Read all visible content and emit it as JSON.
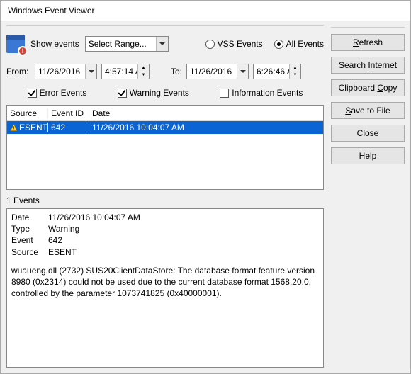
{
  "windowTitle": "Windows Event Viewer",
  "top": {
    "showEvents": "Show events",
    "selectRange": "Select Range...",
    "vssEvents": "VSS Events",
    "allEvents": "All Events"
  },
  "range": {
    "fromLabel": "From:",
    "fromDate": "11/26/2016",
    "fromTime": "4:57:14 A",
    "toLabel": "To:",
    "toDate": "11/26/2016",
    "toTime": "6:26:46 A"
  },
  "filters": {
    "error": "Error Events",
    "warning": "Warning Events",
    "info": "Information Events"
  },
  "columns": {
    "source": "Source",
    "eventId": "Event ID",
    "date": "Date"
  },
  "rows": [
    {
      "source": "ESENT",
      "eventId": "642",
      "date": "11/26/2016 10:04:07 AM"
    }
  ],
  "countLabel": "1 Events",
  "detail": {
    "dateLabel": "Date",
    "dateVal": "11/26/2016 10:04:07 AM",
    "typeLabel": "Type",
    "typeVal": "Warning",
    "eventLabel": "Event",
    "eventVal": "642",
    "sourceLabel": "Source",
    "sourceVal": "ESENT",
    "body": "wuaueng.dll (2732) SUS20ClientDataStore: The database format feature version 8980 (0x2314) could not be used due to the current database format 1568.20.0, controlled by the parameter 1073741825 (0x40000001)."
  },
  "buttons": {
    "refresh": "efresh",
    "search": "nternet",
    "searchPre": "Search ",
    "clipboard": "opy",
    "clipboardPre": "Clipboard ",
    "save": "ave to File",
    "close": "Close",
    "help": "Help"
  }
}
